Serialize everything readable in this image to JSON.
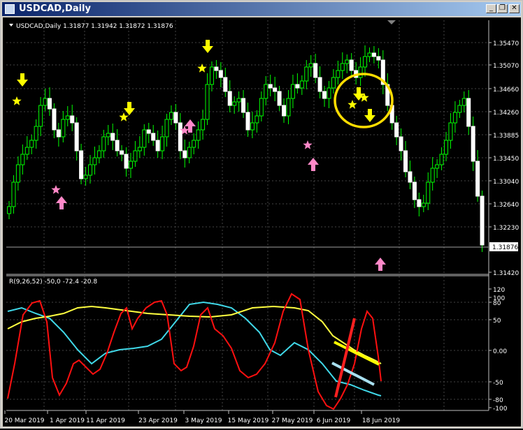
{
  "window": {
    "title": "USDCAD,Daily",
    "min_glyph": "_",
    "restore_glyph": "❐",
    "close_glyph": "✕"
  },
  "main_chart": {
    "header": "USDCAD,Daily  1.31877 1.31942 1.31872 1.31876",
    "price_ticks": [
      "1.35470",
      "1.35070",
      "1.34660",
      "1.34260",
      "1.33885",
      "1.33450",
      "1.33040",
      "1.32640",
      "1.32230",
      "1.31420"
    ],
    "current_price": "1.31876",
    "colors": {
      "up_candle": "#000000",
      "up_outline": "#00ff00",
      "down_candle": "#ffffff",
      "wick": "#00ff00",
      "grid": "#3c3c3c",
      "sell_arrow": "#ffff00",
      "buy_arrow": "#ff88c8",
      "circle": "#ffdd00"
    },
    "icons": {
      "sell": "down-arrow-icon",
      "buy": "up-arrow-icon",
      "star": "star-icon"
    }
  },
  "indicator": {
    "header": "R(9,26,52) -50,0 -72.4 -20.8",
    "ticks": [
      "120",
      "100",
      "80",
      "50",
      "0.00",
      "-50",
      "-80",
      "-100"
    ],
    "colors": {
      "fast": "#ff1010",
      "mid": "#ffff40",
      "slow": "#40d8e8"
    }
  },
  "x_axis": {
    "labels": [
      "20 Mar 2019",
      "1 Apr 2019",
      "11 Apr 2019",
      "23 Apr 2019",
      "3 May 2019",
      "15 May 2019",
      "27 May 2019",
      "6 Jun 2019",
      "18 Jun 2019"
    ]
  }
}
